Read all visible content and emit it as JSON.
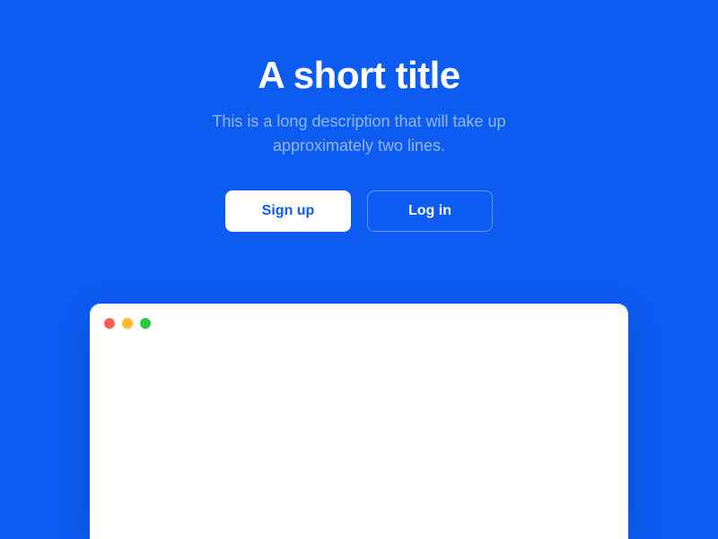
{
  "hero": {
    "title": "A short title",
    "description": "This is a long description that will take up approximately two lines.",
    "signup_label": "Sign up",
    "login_label": "Log in"
  },
  "colors": {
    "background": "#0d5cf2",
    "traffic_red": "#ff5f57",
    "traffic_yellow": "#febc2e",
    "traffic_green": "#28c840"
  }
}
